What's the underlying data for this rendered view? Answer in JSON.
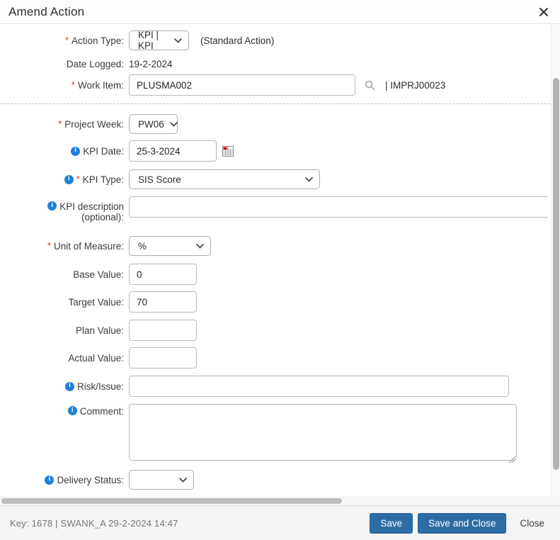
{
  "header": {
    "title": "Amend Action"
  },
  "form": {
    "required_marker": "*",
    "action_type": {
      "label": "Action Type:",
      "value": "KPI | KPI",
      "suffix": "(Standard Action)"
    },
    "date_logged": {
      "label": "Date Logged:",
      "value": "19-2-2024"
    },
    "work_item": {
      "label": "Work Item:",
      "value": "PLUSMA002",
      "ref": "| IMPRJ00023"
    },
    "project_week": {
      "label": "Project Week:",
      "value": "PW06"
    },
    "kpi_date": {
      "label": "KPI Date:",
      "value": "25-3-2024"
    },
    "kpi_type": {
      "label": "KPI Type:",
      "value": "SIS Score"
    },
    "kpi_description": {
      "label_line1": "KPI description",
      "label_line2": "(optional):",
      "value": ""
    },
    "unit_of_measure": {
      "label": "Unit of Measure:",
      "value": "%"
    },
    "base_value": {
      "label": "Base Value:",
      "value": "0"
    },
    "target_value": {
      "label": "Target Value:",
      "value": "70"
    },
    "plan_value": {
      "label": "Plan Value:",
      "value": ""
    },
    "actual_value": {
      "label": "Actual Value:",
      "value": ""
    },
    "risk_issue": {
      "label": "Risk/Issue:",
      "value": ""
    },
    "comment": {
      "label": "Comment:",
      "value": ""
    },
    "delivery_status": {
      "label": "Delivery Status:",
      "value": ""
    },
    "info_glyph": "i"
  },
  "footer": {
    "key_info": "Key: 1678  |  SWANK_A 29-2-2024 14:47",
    "save_label": "Save",
    "save_and_close_label": "Save and Close",
    "close_label": "Close"
  },
  "colors": {
    "primary_button": "#2e6da4",
    "info_icon": "#1d80d9",
    "required_asterisk": "#e02b20"
  }
}
